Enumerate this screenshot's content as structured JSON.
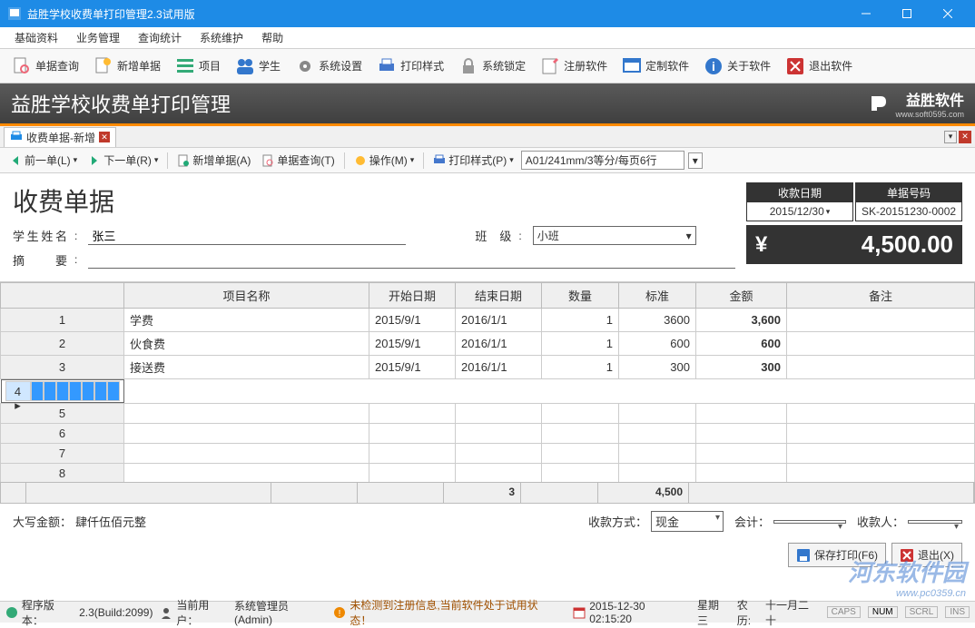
{
  "window": {
    "title": "益胜学校收费单打印管理2.3试用版"
  },
  "menus": [
    "基础资料",
    "业务管理",
    "查询统计",
    "系统维护",
    "帮助"
  ],
  "toolbar": [
    {
      "icon": "search-doc",
      "label": "单据查询"
    },
    {
      "icon": "new-doc",
      "label": "新增单据"
    },
    {
      "icon": "list",
      "label": "项目"
    },
    {
      "icon": "people",
      "label": "学生"
    },
    {
      "icon": "gear",
      "label": "系统设置"
    },
    {
      "icon": "printer",
      "label": "打印样式"
    },
    {
      "icon": "lock",
      "label": "系统锁定"
    },
    {
      "icon": "edit",
      "label": "注册软件"
    },
    {
      "icon": "window",
      "label": "定制软件"
    },
    {
      "icon": "info",
      "label": "关于软件"
    },
    {
      "icon": "exit",
      "label": "退出软件"
    }
  ],
  "banner": {
    "title": "益胜学校收费单打印管理",
    "brand": "益胜软件",
    "brand_url": "www.soft0595.com"
  },
  "tab": {
    "label": "收费单据-新增"
  },
  "toolbar2": {
    "prev": "前一单(L)",
    "next": "下一单(R)",
    "newdoc": "新增单据(A)",
    "query": "单据查询(T)",
    "ops": "操作(M)",
    "printstyle": "打印样式(P)",
    "style_value": "A01/241mm/3等分/每页6行"
  },
  "form": {
    "title": "收费单据",
    "student_label": "学生姓名",
    "student_value": "张三",
    "class_label": "班级",
    "class_value": "小班",
    "summary_label": "摘    要",
    "summary_value": "",
    "date_hdr": "收款日期",
    "date_value": "2015/12/30",
    "docno_hdr": "单据号码",
    "docno_value": "SK-20151230-0002",
    "amount": "4,500.00"
  },
  "grid": {
    "headers": [
      "项目名称",
      "开始日期",
      "结束日期",
      "数量",
      "标准",
      "金额",
      "备注"
    ],
    "rows": [
      {
        "n": "1",
        "name": "学费",
        "start": "2015/9/1",
        "end": "2016/1/1",
        "qty": "1",
        "std": "3600",
        "amt": "3,600",
        "remark": ""
      },
      {
        "n": "2",
        "name": "伙食费",
        "start": "2015/9/1",
        "end": "2016/1/1",
        "qty": "1",
        "std": "600",
        "amt": "600",
        "remark": ""
      },
      {
        "n": "3",
        "name": "接送费",
        "start": "2015/9/1",
        "end": "2016/1/1",
        "qty": "1",
        "std": "300",
        "amt": "300",
        "remark": ""
      }
    ],
    "empty_rows": [
      "4",
      "5",
      "6",
      "7",
      "8"
    ],
    "sum_qty": "3",
    "sum_amt": "4,500"
  },
  "bottom": {
    "upper_label": "大写金额：",
    "upper_value": "肆仟伍佰元整",
    "paymethod_label": "收款方式：",
    "paymethod_value": "现金",
    "accountant_label": "会计：",
    "accountant_value": "",
    "payee_label": "收款人：",
    "payee_value": ""
  },
  "actions": {
    "save": "保存打印(F6)",
    "exit": "退出(X)"
  },
  "status": {
    "ver_label": "程序版本：",
    "ver": "2.3(Build:2099)",
    "user_label": "当前用户：",
    "user": "系统管理员(Admin)",
    "warn": "未检测到注册信息,当前软件处于试用状态！",
    "datetime": "2015-12-30 02:15:20",
    "weekday": "星期三",
    "lunar_label": "农历:",
    "lunar": "十一月二十",
    "caps": "CAPS",
    "num": "NUM",
    "scrl": "SCRL",
    "ins": "INS"
  },
  "watermark": {
    "main": "河东软件园",
    "sub": "www.pc0359.cn"
  }
}
